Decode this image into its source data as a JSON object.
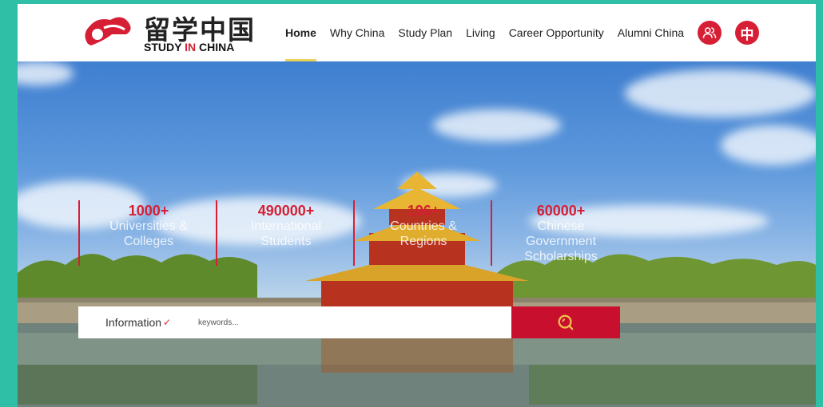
{
  "brand": {
    "name_cn": "留学中国",
    "name_en_part1": "STUDY ",
    "name_en_part2": "IN",
    "name_en_part3": " CHINA",
    "accent_color": "#d61f35"
  },
  "nav": {
    "items": [
      {
        "label": "Home",
        "active": true
      },
      {
        "label": "Why China"
      },
      {
        "label": "Study Plan"
      },
      {
        "label": "Living"
      },
      {
        "label": "Career Opportunity"
      },
      {
        "label": "Alumni China"
      }
    ],
    "user_icon": "user-group-icon",
    "language_label": "中"
  },
  "stats": [
    {
      "number": "1000+",
      "line1": "Universities &",
      "line2": "Colleges",
      "line3": ""
    },
    {
      "number": "490000+",
      "line1": "International",
      "line2": "Students",
      "line3": ""
    },
    {
      "number": "196+",
      "line1": "Countries &",
      "line2": "Regions",
      "line3": ""
    },
    {
      "number": "60000+",
      "line1": "Chinese",
      "line2": "Government",
      "line3": "Scholarships"
    }
  ],
  "search": {
    "category": "Information",
    "placeholder": "keywords...",
    "button_icon": "search-icon"
  }
}
